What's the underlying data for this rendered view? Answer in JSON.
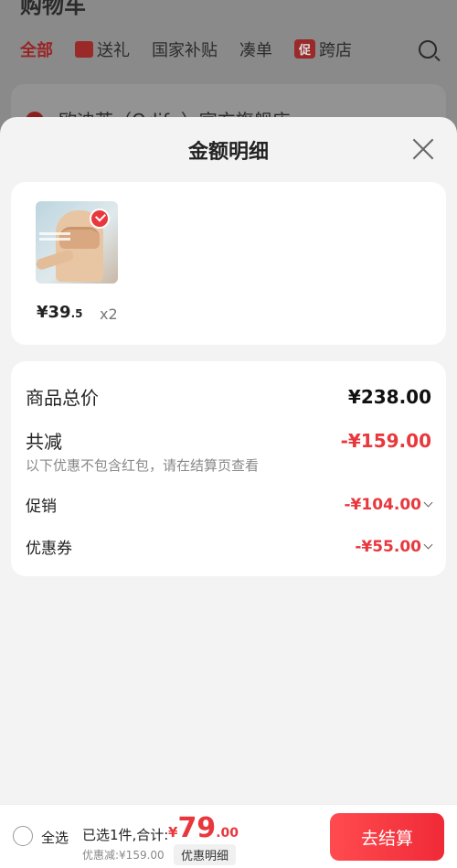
{
  "background": {
    "title": "购物车",
    "tabs": [
      "全部",
      "送礼",
      "国家补贴",
      "凑单",
      "跨店"
    ],
    "promo_badge": "促",
    "store_name": "欧迪芙（Odifu）官方旗舰店"
  },
  "sheet": {
    "title": "金额明细",
    "product": {
      "price_int": "¥39",
      "price_dec": ".5",
      "quantity": "x2"
    },
    "summary": {
      "total_label": "商品总价",
      "total_value": "¥238.00",
      "reduce_label": "共减",
      "reduce_value": "-¥159.00",
      "hint": "以下优惠不包含红包，请在结算页查看",
      "promo_label": "促销",
      "promo_value": "-¥104.00",
      "coupon_label": "优惠券",
      "coupon_value": "-¥55.00"
    }
  },
  "bottom_bar": {
    "select_all": "全选",
    "selected_text": "已选1件,合计:",
    "currency": "¥",
    "total_int": "79",
    "total_dec": ".00",
    "discount_line": "优惠减:¥159.00",
    "detail_button": "优惠明细",
    "checkout_button": "去结算"
  },
  "colors": {
    "accent": "#e8383d",
    "sheet_bg": "#f3f3f3",
    "overlay": "#8c8c8c"
  }
}
